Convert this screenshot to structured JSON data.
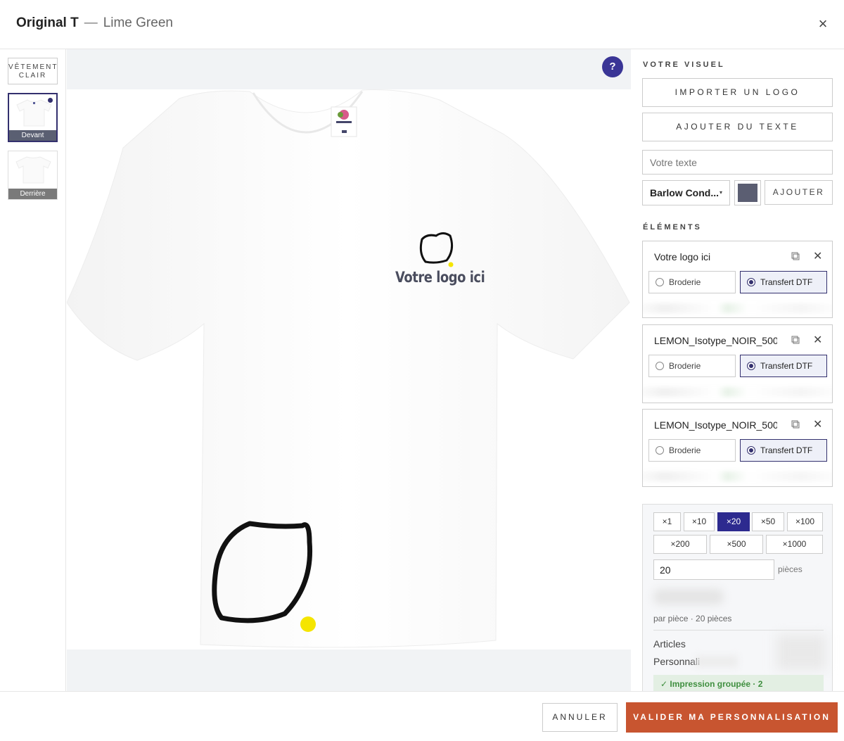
{
  "header": {
    "product_name": "Original T",
    "separator": "—",
    "color_name": "Lime Green",
    "close_icon": "×"
  },
  "left_rail": {
    "garment_toggle": "VÊTEMENT CLAIR",
    "views": [
      {
        "label": "Devant",
        "active": true
      },
      {
        "label": "Derrière",
        "active": false
      }
    ]
  },
  "canvas": {
    "help_label": "?",
    "logo_placeholder_text": "Votre logo ici",
    "marker_color": "#f5e500",
    "background_color": "#f1f3f5"
  },
  "panel": {
    "visual_section_title": "VOTRE VISUEL",
    "import_logo_label": "IMPORTER UN LOGO",
    "add_text_label": "AJOUTER DU TEXTE",
    "text_input_placeholder": "Votre texte",
    "font_selected": "Barlow Cond...",
    "text_color": "#5b5e72",
    "add_label": "AJOUTER",
    "elements_section_title": "ÉLÉMENTS",
    "elements": [
      {
        "name": "Votre logo ici",
        "option_a": "Broderie",
        "option_b": "Transfert DTF",
        "selected": "Transfert DTF"
      },
      {
        "name": "LEMON_Isotype_NOIR_500",
        "option_a": "Broderie",
        "option_b": "Transfert DTF",
        "selected": "Transfert DTF"
      },
      {
        "name": "LEMON_Isotype_NOIR_500",
        "option_a": "Broderie",
        "option_b": "Transfert DTF",
        "selected": "Transfert DTF"
      }
    ]
  },
  "quantity": {
    "presets": [
      "×1",
      "×10",
      "×20",
      "×50",
      "×100",
      "×200",
      "×500",
      "×1000"
    ],
    "selected_preset": "×20",
    "value": "20",
    "unit_label": "pièces",
    "per_piece_label": "par pièce · 20 pièces",
    "articles_label": "Articles",
    "personalisation_label": "Personnali",
    "badge_label": "✓ Impression groupée · 2"
  },
  "footer": {
    "cancel_label": "ANNULER",
    "validate_label": "VALIDER MA PERSONNALISATION"
  },
  "colors": {
    "accent": "#2d2a8f",
    "primary_action": "#c85530",
    "help_button": "#3a3596"
  }
}
